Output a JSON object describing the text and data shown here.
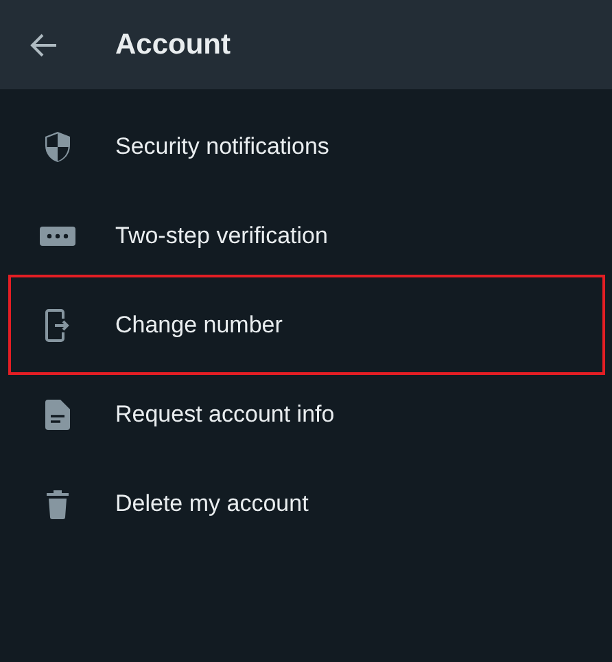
{
  "header": {
    "title": "Account"
  },
  "items": [
    {
      "label": "Security notifications",
      "kind": "shield",
      "highlighted": false
    },
    {
      "label": "Two-step verification",
      "kind": "dots",
      "highlighted": false
    },
    {
      "label": "Change number",
      "kind": "phone",
      "highlighted": true
    },
    {
      "label": "Request account info",
      "kind": "doc",
      "highlighted": false
    },
    {
      "label": "Delete my account",
      "kind": "trash",
      "highlighted": false
    }
  ]
}
